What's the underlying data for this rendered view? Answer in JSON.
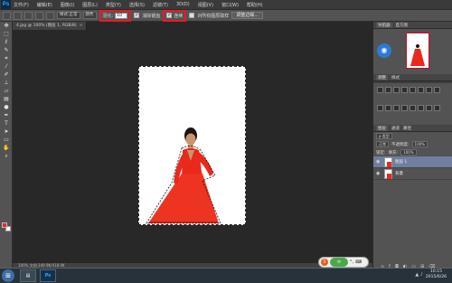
{
  "app": {
    "logo": "Ps"
  },
  "menubar": [
    "文件(F)",
    "编辑(E)",
    "图像(I)",
    "图层(L)",
    "类型(Y)",
    "选择(S)",
    "滤镜(T)",
    "3D(D)",
    "视图(V)",
    "窗口(W)",
    "帮助(H)"
  ],
  "options": {
    "size_dropdown": "样式:正常",
    "mode_dropdown": "颜色",
    "feather_label": "羽化:",
    "feather_value": "10",
    "antialias_label": "消除锯齿",
    "check_mark": "✓",
    "contig_label": "连续",
    "sample_all_label": "对所有图层取样",
    "refine_button": "调整边缘..."
  },
  "document": {
    "tab_title": "4.jpg @ 100% (图层 1, RGB/8)",
    "close": "×",
    "status": "100%    文档:349.9K/418.9K"
  },
  "navigator": {
    "tabs": [
      "导航器",
      "直方图"
    ]
  },
  "adjustments": {
    "tabs": [
      "调整",
      "样式"
    ]
  },
  "layers": {
    "tabs": [
      "图层",
      "通道",
      "路径"
    ],
    "kind_label": "ρ 类型",
    "blend_mode": "正常",
    "opacity_label": "不透明度:",
    "opacity_value": "100%",
    "lock_label": "锁定:",
    "fill_label": "填充:",
    "fill_value": "100%",
    "items": [
      {
        "name": "图层 1",
        "selected": true
      },
      {
        "name": "背景",
        "selected": false
      }
    ]
  },
  "ime": {
    "label": "S",
    "green_text": "中"
  },
  "taskbar": {
    "clock_time": "10:15",
    "clock_date": "2015/6/26",
    "tray": "▲ ♪"
  },
  "colors": {
    "foreground": "#e8291b",
    "background": "#ffffff",
    "highlight": "#e51c23"
  },
  "icons": [
    "move-icon",
    "marquee-icon",
    "lasso-icon",
    "quick-select-icon",
    "crop-icon",
    "eyedropper-icon",
    "brush-icon",
    "stamp-icon",
    "eraser-icon",
    "gradient-icon",
    "dodge-icon",
    "pen-icon",
    "type-icon",
    "path-select-icon",
    "shape-icon",
    "hand-icon",
    "zoom-icon"
  ]
}
